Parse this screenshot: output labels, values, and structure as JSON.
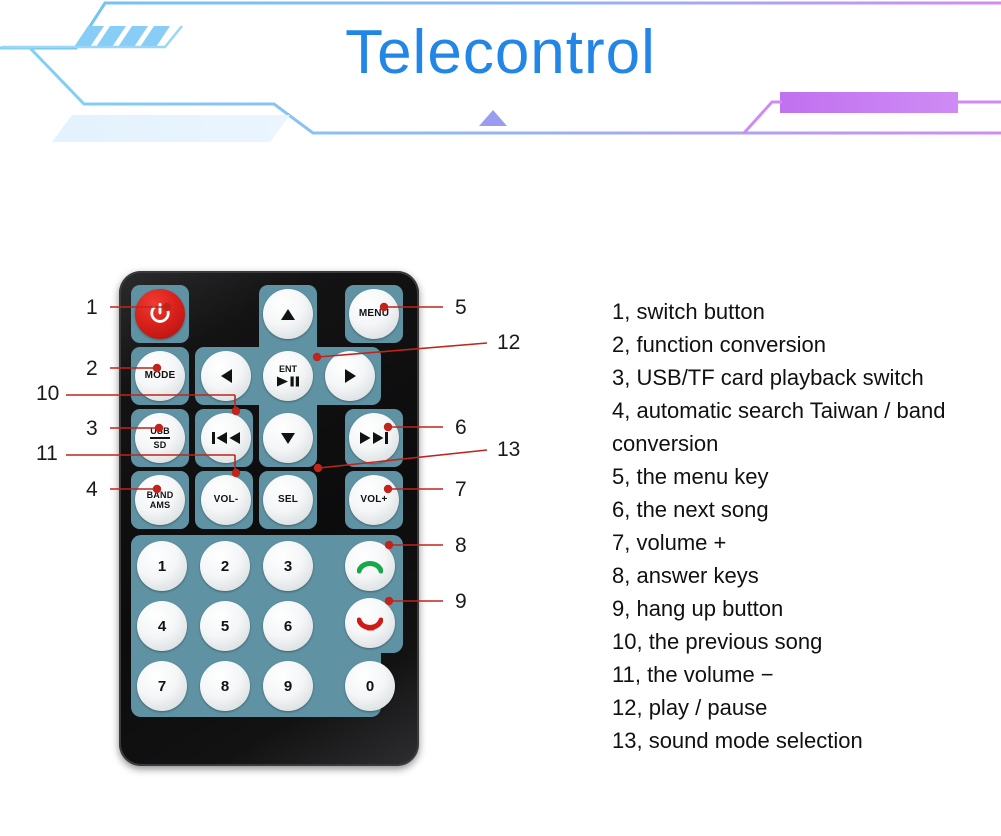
{
  "header": {
    "title": "Telecontrol",
    "title_color": "#2286e6",
    "accent_blue": "#7ec8f2",
    "accent_purple": "#c57cf0",
    "stripe_count": 4,
    "triangle_icon": "triangle-up-icon"
  },
  "remote": {
    "name": "ir-remote-control",
    "body_color": "#101011",
    "pad_color": "#5f93a3",
    "power_color": "#d8201b",
    "buttons": [
      {
        "id": "power",
        "label": "",
        "icon": "power-icon"
      },
      {
        "id": "mode",
        "label": "MODE",
        "icon": ""
      },
      {
        "id": "usbsd",
        "label_top": "USB",
        "label_bottom": "SD",
        "icon": ""
      },
      {
        "id": "bandams",
        "label_top": "BAND",
        "label_bottom": "AMS",
        "icon": ""
      },
      {
        "id": "up",
        "label": "",
        "icon": "triangle-up-icon"
      },
      {
        "id": "left",
        "label": "",
        "icon": "triangle-left-icon"
      },
      {
        "id": "ent",
        "label": "ENT",
        "icon": "play-pause-icon"
      },
      {
        "id": "right",
        "label": "",
        "icon": "triangle-right-icon"
      },
      {
        "id": "prev",
        "label": "",
        "icon": "previous-track-icon"
      },
      {
        "id": "down",
        "label": "",
        "icon": "triangle-down-icon"
      },
      {
        "id": "next",
        "label": "",
        "icon": "next-track-icon"
      },
      {
        "id": "menu",
        "label": "MENU",
        "icon": ""
      },
      {
        "id": "volminus",
        "label": "VOL-",
        "icon": ""
      },
      {
        "id": "sel",
        "label": "SEL",
        "icon": ""
      },
      {
        "id": "volplus",
        "label": "VOL+",
        "icon": ""
      },
      {
        "id": "answer",
        "label": "",
        "icon": "phone-answer-icon"
      },
      {
        "id": "hangup",
        "label": "",
        "icon": "phone-hangup-icon"
      }
    ],
    "numeric_keys": [
      "1",
      "2",
      "3",
      "4",
      "5",
      "6",
      "7",
      "8",
      "9",
      "0"
    ],
    "labels": {
      "power": "",
      "mode": "MODE",
      "usb": "USB",
      "sd": "SD",
      "band": "BAND",
      "ams": "AMS",
      "ent": "ENT",
      "menu": "MENU",
      "volminus": "VOL-",
      "sel": "SEL",
      "volplus": "VOL+",
      "k1": "1",
      "k2": "2",
      "k3": "3",
      "k4": "4",
      "k5": "5",
      "k6": "6",
      "k7": "7",
      "k8": "8",
      "k9": "9",
      "k0": "0"
    }
  },
  "callouts": {
    "marker_color": "#c0241b",
    "left": [
      {
        "num": "1"
      },
      {
        "num": "2"
      },
      {
        "num": "10"
      },
      {
        "num": "3"
      },
      {
        "num": "11"
      },
      {
        "num": "4"
      }
    ],
    "right": [
      {
        "num": "5"
      },
      {
        "num": "12"
      },
      {
        "num": "6"
      },
      {
        "num": "13"
      },
      {
        "num": "7"
      },
      {
        "num": "8"
      },
      {
        "num": "9"
      }
    ]
  },
  "legend": {
    "items": [
      "1, switch button",
      "2, function conversion",
      "3, USB/TF card playback switch",
      "4, automatic search Taiwan / band conversion",
      "5, the menu key",
      "6, the next song",
      "7, volume +",
      "8, answer keys",
      "9, hang up button",
      "10, the previous song",
      "11, the volume −",
      "12, play / pause",
      "13, sound mode selection"
    ]
  }
}
